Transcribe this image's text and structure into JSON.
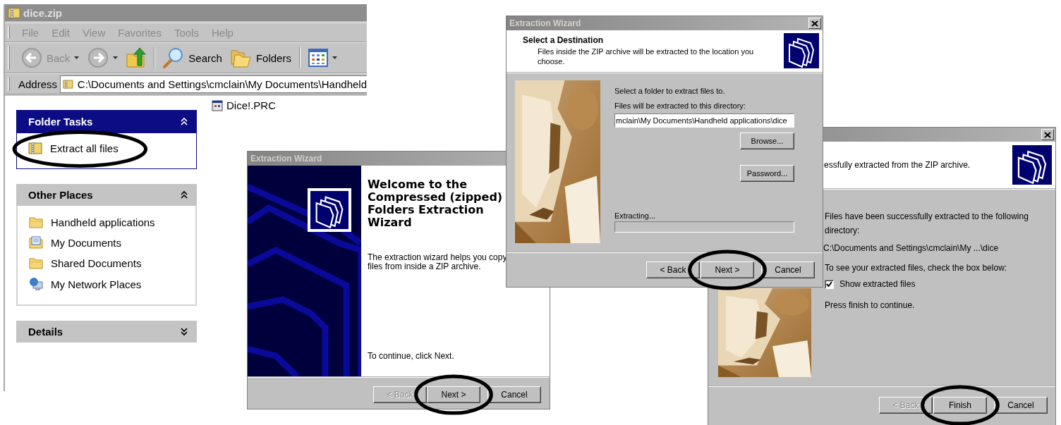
{
  "explorer": {
    "title": "dice.zip",
    "menu": [
      "File",
      "Edit",
      "View",
      "Favorites",
      "Tools",
      "Help"
    ],
    "toolbar": [
      {
        "kind": "back",
        "label": "Back",
        "disabled": true
      },
      {
        "kind": "forward"
      },
      {
        "kind": "up"
      },
      {
        "kind": "search",
        "label": "Search",
        "disabled": false
      },
      {
        "kind": "folders",
        "label": "Folders",
        "disabled": false
      },
      {
        "kind": "views"
      }
    ],
    "address": {
      "label": "Address",
      "value": "C:\\Documents and Settings\\cmclain\\My Documents\\Handheld"
    },
    "panels": [
      {
        "title": "Folder Tasks",
        "kind": "special",
        "expanded": true,
        "items": [
          {
            "label": "Extract all files",
            "kind": "zip",
            "circled": true
          }
        ]
      },
      {
        "title": "Other Places",
        "kind": "normal",
        "expanded": true,
        "items": [
          {
            "label": "Handheld applications",
            "kind": "folder",
            "circled": false
          },
          {
            "label": "My Documents",
            "kind": "documents",
            "circled": false
          },
          {
            "label": "Shared Documents",
            "kind": "folder",
            "circled": false
          },
          {
            "label": "My Network Places",
            "kind": "network",
            "circled": false
          }
        ]
      },
      {
        "title": "Details",
        "kind": "normal",
        "expanded": false
      }
    ],
    "files": [
      {
        "name": "Dice!.PRC"
      }
    ]
  },
  "welcome_wizard": {
    "title": "Extraction Wizard",
    "heading": "Welcome to the Compressed (zipped) Folders Extraction Wizard",
    "intro": "The extraction wizard helps you copy files from inside a ZIP archive.",
    "footer": "To continue, click Next.",
    "buttons": [
      {
        "label": "< Back",
        "disabled": true,
        "circled": false
      },
      {
        "label": "Next >",
        "disabled": false,
        "circled": true
      },
      {
        "label": "Cancel",
        "disabled": false,
        "circled": false
      }
    ]
  },
  "destination_wizard": {
    "title": "Extraction Wizard",
    "heading": "Select a Destination",
    "subheading": "Files inside the ZIP archive will be extracted to the location you choose.",
    "prompt": "Select a folder to extract files to.",
    "field_label": "Files will be extracted to this directory:",
    "path": "mclain\\My Documents\\Handheld applications\\dice",
    "side_buttons": [
      {
        "label": "Browse..."
      },
      {
        "label": "Password..."
      }
    ],
    "progress_label": "Extracting...",
    "progress": {
      "level": 0
    },
    "buttons": [
      {
        "label": "< Back",
        "disabled": false,
        "circled": false
      },
      {
        "label": "Next >",
        "disabled": false,
        "circled": true
      },
      {
        "label": "Cancel",
        "disabled": false,
        "circled": false
      }
    ]
  },
  "complete_wizard": {
    "header_text": "essfully extracted from the ZIP archive.",
    "message": "Files have been successfully extracted to the following directory:",
    "path": "C:\\Documents and Settings\\cmclain\\My ...\\dice",
    "check_hint": "To see your extracted files, check the box below:",
    "checkbox": {
      "label": "Show extracted files",
      "checked": true
    },
    "closing": "Press finish to continue.",
    "buttons": [
      {
        "label": "< Back",
        "disabled": true,
        "circled": false
      },
      {
        "label": "Finish",
        "disabled": false,
        "circled": true
      },
      {
        "label": "Cancel",
        "disabled": false,
        "circled": false
      }
    ]
  }
}
